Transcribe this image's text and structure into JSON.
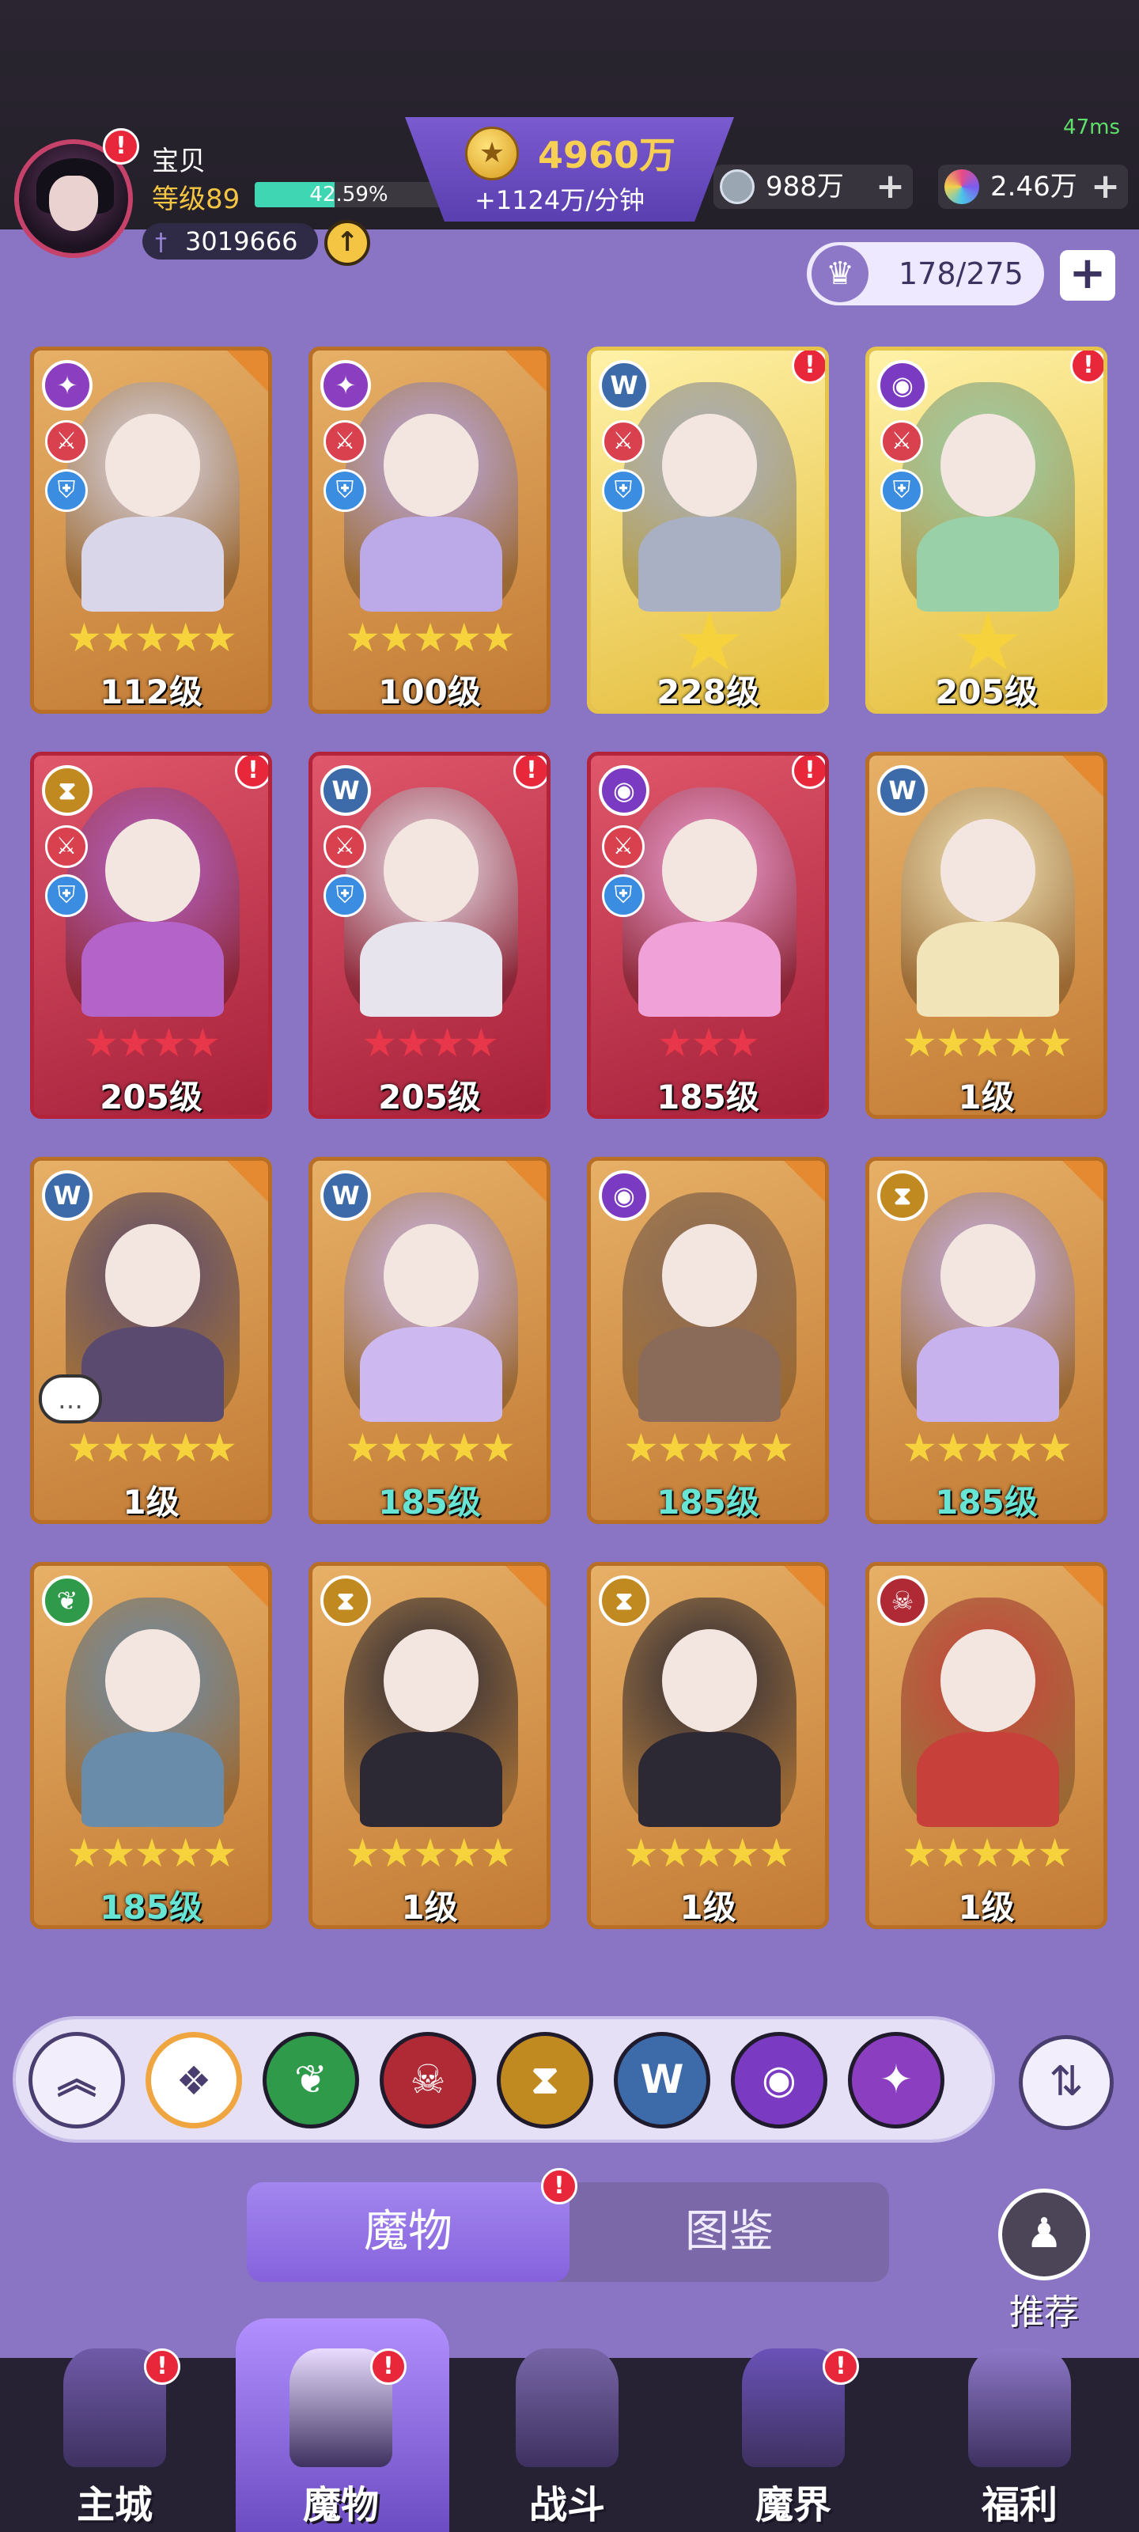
{
  "status": {
    "ping": "47ms"
  },
  "player": {
    "name": "宝贝",
    "level": "等级89",
    "xp_text": "42.59%",
    "xp_fraction": 0.4259,
    "power": "3019666",
    "upgrade_icon": "arrow-up-icon"
  },
  "currency": {
    "gold_amount": "4960万",
    "gold_rate": "+1124万/分钟",
    "silver": "988万",
    "gems": "2.46万"
  },
  "collection": {
    "count": "178/275"
  },
  "cards": [
    {
      "level": "112级",
      "stars": 5,
      "frame": "orange",
      "star_color": "gold",
      "element": "storm",
      "notify": false,
      "level_color": "white",
      "big_star": false
    },
    {
      "level": "100级",
      "stars": 5,
      "frame": "orange",
      "star_color": "gold",
      "element": "storm",
      "notify": false,
      "level_color": "white",
      "big_star": false
    },
    {
      "level": "228级",
      "stars": 1,
      "frame": "gold",
      "star_color": "gold",
      "element": "wolf",
      "notify": true,
      "level_color": "white",
      "big_star": true
    },
    {
      "level": "205级",
      "stars": 1,
      "frame": "gold",
      "star_color": "gold",
      "element": "eye",
      "notify": true,
      "level_color": "white",
      "big_star": true
    },
    {
      "level": "205级",
      "stars": 4,
      "frame": "red",
      "star_color": "red",
      "element": "hourglass",
      "notify": true,
      "level_color": "white",
      "big_star": false
    },
    {
      "level": "205级",
      "stars": 4,
      "frame": "red",
      "star_color": "red",
      "element": "wolf",
      "notify": true,
      "level_color": "white",
      "big_star": false
    },
    {
      "level": "185级",
      "stars": 3,
      "frame": "red",
      "star_color": "red",
      "element": "eye",
      "notify": true,
      "level_color": "white",
      "big_star": false
    },
    {
      "level": "1级",
      "stars": 5,
      "frame": "orange",
      "star_color": "gold",
      "element": "wolf",
      "notify": false,
      "level_color": "white",
      "big_star": false
    },
    {
      "level": "1级",
      "stars": 5,
      "frame": "orange",
      "star_color": "gold",
      "element": "wolf",
      "notify": false,
      "level_color": "white",
      "big_star": false
    },
    {
      "level": "185级",
      "stars": 5,
      "frame": "orange",
      "star_color": "gold",
      "element": "wolf",
      "notify": false,
      "level_color": "teal",
      "big_star": false
    },
    {
      "level": "185级",
      "stars": 5,
      "frame": "orange",
      "star_color": "gold",
      "element": "eye",
      "notify": false,
      "level_color": "teal",
      "big_star": false
    },
    {
      "level": "185级",
      "stars": 5,
      "frame": "orange",
      "star_color": "gold",
      "element": "hourglass",
      "notify": false,
      "level_color": "teal",
      "big_star": false
    },
    {
      "level": "185级",
      "stars": 5,
      "frame": "orange",
      "star_color": "gold",
      "element": "leaf",
      "notify": false,
      "level_color": "teal",
      "big_star": false
    },
    {
      "level": "1级",
      "stars": 5,
      "frame": "orange",
      "star_color": "gold",
      "element": "hourglass",
      "notify": false,
      "level_color": "white",
      "big_star": false
    },
    {
      "level": "1级",
      "stars": 5,
      "frame": "orange",
      "star_color": "gold",
      "element": "hourglass",
      "notify": false,
      "level_color": "white",
      "big_star": false
    },
    {
      "level": "1级",
      "stars": 5,
      "frame": "orange",
      "star_color": "gold",
      "element": "demon",
      "notify": false,
      "level_color": "white",
      "big_star": false
    }
  ],
  "filters": [
    {
      "name": "collapse-filter",
      "icon": "chevrons-up-icon"
    },
    {
      "name": "all-filter",
      "icon": "diamond-grid-icon"
    },
    {
      "name": "leaf-filter",
      "icon": "leaf-icon"
    },
    {
      "name": "demon-filter",
      "icon": "demon-mask-icon"
    },
    {
      "name": "hourglass-filter",
      "icon": "hourglass-icon"
    },
    {
      "name": "wolf-filter",
      "icon": "wolf-icon"
    },
    {
      "name": "eye-filter",
      "icon": "eye-icon"
    },
    {
      "name": "storm-filter",
      "icon": "storm-icon"
    }
  ],
  "tabs": {
    "monsters": "魔物",
    "codex": "图鉴"
  },
  "recommend": {
    "label": "推荐"
  },
  "nav": [
    {
      "label": "主城",
      "icon": "castle-icon",
      "badge": true
    },
    {
      "label": "魔物",
      "icon": "monster-flame-icon",
      "badge": true,
      "active": true
    },
    {
      "label": "战斗",
      "icon": "battle-shield-icon",
      "badge": false
    },
    {
      "label": "魔界",
      "icon": "demon-realm-icon",
      "badge": true
    },
    {
      "label": "福利",
      "icon": "treasure-chest-icon",
      "badge": false
    }
  ],
  "colors": {
    "background": "#8a75c4",
    "gold_text": "#f7cf52",
    "xp_fill": "#3fd6b4",
    "teal_level": "#68e4d4",
    "notify_red": "#e8273a"
  }
}
